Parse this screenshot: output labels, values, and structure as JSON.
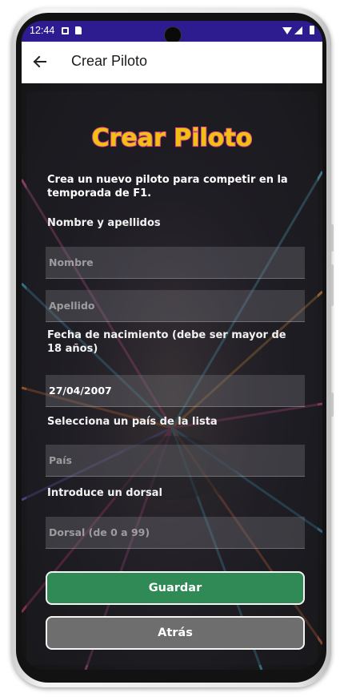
{
  "status_bar": {
    "time": "12:44"
  },
  "app_bar": {
    "title": "Crear Piloto"
  },
  "logo": {
    "text": "Crear Piloto"
  },
  "form": {
    "intro": "Crea un nuevo piloto para competir en la temporada de F1.",
    "name_section_label": "Nombre y apellidos",
    "first_name": {
      "value": "",
      "placeholder": "Nombre"
    },
    "last_name": {
      "value": "",
      "placeholder": "Apellido"
    },
    "birthdate_label": "Fecha de nacimiento (debe ser mayor de 18 años)",
    "birthdate": {
      "value": "27/04/2007",
      "placeholder": ""
    },
    "country_label": "Selecciona un país de la lista",
    "country": {
      "value": "",
      "placeholder": "País"
    },
    "number_label": "Introduce un dorsal",
    "number": {
      "value": "",
      "placeholder": "Dorsal (de 0 a 99)"
    }
  },
  "buttons": {
    "save": "Guardar",
    "back": "Atrás"
  },
  "colors": {
    "status_bar": "#2c1c8f",
    "save_button": "#2f8a56",
    "back_button": "#6e6e6e",
    "logo_fill": "#f0c20f",
    "logo_outline": "#e84a8a"
  }
}
